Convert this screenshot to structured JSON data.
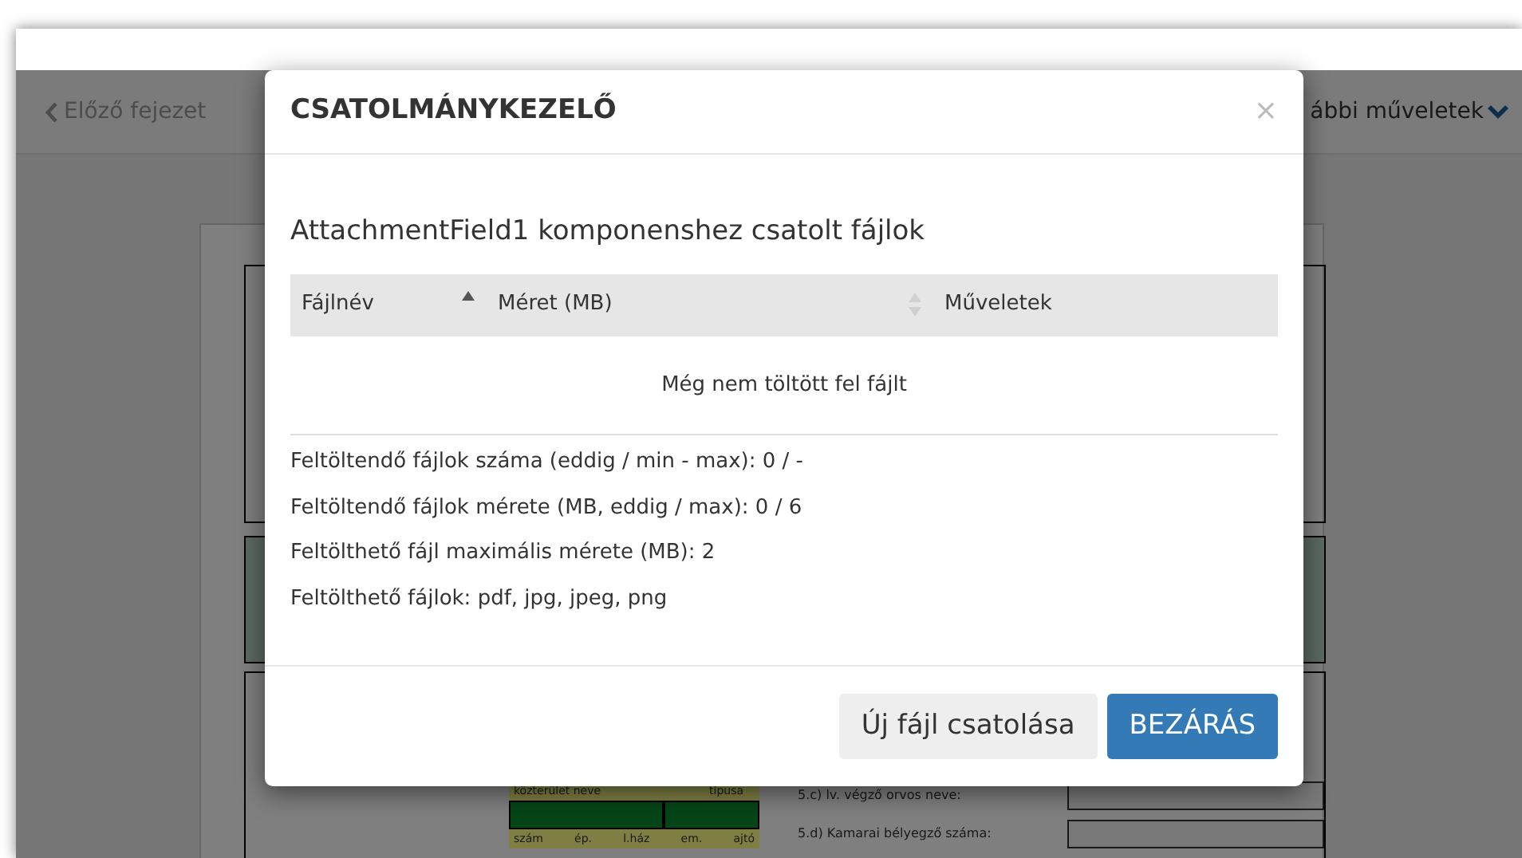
{
  "nav": {
    "back": "Előző fejezet",
    "more": "ábbi műveletek"
  },
  "background_form": {
    "address_labels": [
      "közterület neve",
      "típusa"
    ],
    "number_labels": [
      "szám",
      "ép.",
      "l.ház",
      "em.",
      "ajtó"
    ],
    "fields": [
      {
        "label": "5.c) lv. végző orvos neve:"
      },
      {
        "label": "5.d) Kamarai bélyegző száma:"
      }
    ]
  },
  "modal": {
    "title": "CSATOLMÁNYKEZELŐ",
    "close": "×",
    "subtitle": "AttachmentField1 komponenshez csatolt fájlok",
    "columns": [
      {
        "label": "Fájlnév",
        "sortable": true,
        "sorted": true
      },
      {
        "label": "Méret (MB)",
        "sortable": true,
        "sorted": false
      },
      {
        "label": "Műveletek",
        "sortable": false
      }
    ],
    "empty_text": "Még nem töltött fel fájlt",
    "info": [
      "Feltöltendő fájlok száma (eddig / min - max): 0 / -",
      "Feltöltendő fájlok mérete (MB, eddig / max): 0 / 6",
      "Feltölthető fájl maximális mérete (MB): 2",
      "Feltölthető fájlok: pdf, jpg, jpeg, png"
    ],
    "buttons": [
      {
        "label": "Új fájl csatolása",
        "kind": "secondary"
      },
      {
        "label": "BEZÁRÁS",
        "kind": "primary"
      }
    ]
  }
}
